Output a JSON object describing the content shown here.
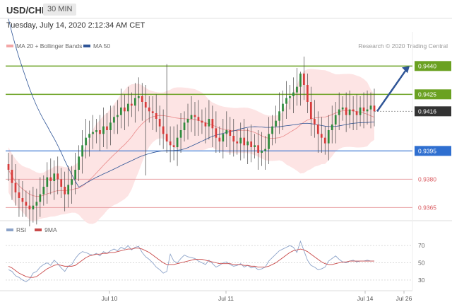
{
  "header": {
    "symbol": "USD/CHF",
    "timeframe": "30 MIN",
    "datetime": "Tuesday, July 14, 2020 2:12:34 AM CET"
  },
  "legend": {
    "ma20": "MA 20 + Bollinger Bands",
    "ma50": "MA 50",
    "copyright": "Research © 2020 Trading Central"
  },
  "rsi_legend": {
    "rsi": "RSI",
    "ma": "9MA"
  },
  "colors": {
    "band": "#fde4e4",
    "ma20": "#e57373",
    "ma50": "#2f5597",
    "resistance": "#6aa121",
    "support_blue": "#2f6fd0",
    "support_red": "#d9595f",
    "arrow": "#2f5597",
    "candle_up": "#2e8b3d",
    "candle_down": "#d63b3b",
    "rsi_line": "#8ca3c9",
    "rsi_ma": "#c94a4a"
  },
  "chart_data": {
    "type": "candlestick",
    "symbol": "USD/CHF",
    "timeframe": "30 MIN",
    "ylim": [
      0.9358,
      0.9448
    ],
    "x_ticks": [
      "Jul 10",
      "Jul 11",
      "Jul 14",
      "Jul 26"
    ],
    "levels": [
      {
        "value": 0.944,
        "label": "0.9440",
        "style": "resistance"
      },
      {
        "value": 0.9425,
        "label": "0.9425",
        "style": "resistance"
      },
      {
        "value": 0.9416,
        "label": "0.9416",
        "style": "current"
      },
      {
        "value": 0.9395,
        "label": "0.9395",
        "style": "support_blue"
      },
      {
        "value": 0.938,
        "label": "0.9380",
        "style": "support_red"
      },
      {
        "value": 0.9365,
        "label": "0.9365",
        "style": "support_red"
      }
    ],
    "projection": {
      "from": 0.9416,
      "to": 0.944,
      "direction": "up"
    },
    "close": [
      0.9385,
      0.9378,
      0.9373,
      0.937,
      0.9368,
      0.9366,
      0.9364,
      0.9366,
      0.9368,
      0.9372,
      0.9376,
      0.9381,
      0.9379,
      0.9383,
      0.938,
      0.9376,
      0.9372,
      0.9377,
      0.938,
      0.9385,
      0.9392,
      0.9398,
      0.9402,
      0.9404,
      0.9405,
      0.9406,
      0.9404,
      0.9408,
      0.9406,
      0.941,
      0.9413,
      0.9414,
      0.9418,
      0.9416,
      0.942,
      0.9419,
      0.9423,
      0.9424,
      0.9421,
      0.9418,
      0.9416,
      0.9415,
      0.9412,
      0.9408,
      0.9404,
      0.94,
      0.9398,
      0.9397,
      0.9402,
      0.9406,
      0.941,
      0.9412,
      0.9414,
      0.9413,
      0.9411,
      0.941,
      0.9408,
      0.9412,
      0.9407,
      0.9402,
      0.94,
      0.9404,
      0.9406,
      0.9403,
      0.94,
      0.9399,
      0.9402,
      0.9398,
      0.94,
      0.9397,
      0.9398,
      0.9394,
      0.9395,
      0.9396,
      0.9404,
      0.9408,
      0.9411,
      0.9416,
      0.942,
      0.9423,
      0.9424,
      0.9426,
      0.9429,
      0.9436,
      0.943,
      0.9421,
      0.9412,
      0.9409,
      0.9404,
      0.9402,
      0.9399,
      0.9406,
      0.9409,
      0.9414,
      0.9417,
      0.9418,
      0.9414,
      0.9417,
      0.9416,
      0.9414,
      0.9418,
      0.9416,
      0.9417,
      0.9419,
      0.9416
    ],
    "spikes": [
      {
        "index": 45,
        "high": 0.9441
      },
      {
        "index": 83,
        "high": 0.9437
      },
      {
        "index": 39,
        "low": 0.9382
      }
    ],
    "rsi": {
      "ticks": [
        70,
        50,
        30
      ],
      "ylim": [
        20,
        80
      ],
      "rsi_values": [
        42,
        40,
        35,
        33,
        30,
        28,
        31,
        38,
        40,
        45,
        48,
        50,
        47,
        53,
        49,
        44,
        40,
        46,
        48,
        55,
        60,
        63,
        62,
        60,
        59,
        61,
        58,
        63,
        61,
        64,
        66,
        64,
        68,
        66,
        70,
        65,
        68,
        69,
        62,
        57,
        54,
        50,
        45,
        42,
        38,
        40,
        60,
        52,
        50,
        55,
        59,
        57,
        56,
        55,
        52,
        50,
        48,
        53,
        49,
        45,
        47,
        50,
        51,
        48,
        46,
        47,
        49,
        45,
        47,
        44,
        45,
        42,
        43,
        45,
        52,
        56,
        60,
        64,
        66,
        68,
        70,
        68,
        62,
        75,
        64,
        53,
        47,
        45,
        42,
        43,
        45,
        52,
        55,
        58,
        54,
        51,
        50,
        52,
        53,
        51,
        52,
        52,
        53,
        52,
        52
      ],
      "ma_values": [
        46,
        44,
        41,
        38,
        36,
        34,
        33,
        33,
        34,
        37,
        40,
        43,
        45,
        47,
        48,
        47,
        46,
        46,
        46,
        47,
        50,
        53,
        56,
        58,
        59,
        60,
        60,
        61,
        61,
        62,
        62,
        63,
        64,
        65,
        66,
        66,
        67,
        67,
        66,
        64,
        62,
        59,
        56,
        53,
        50,
        48,
        48,
        48,
        49,
        50,
        51,
        52,
        53,
        54,
        54,
        54,
        53,
        52,
        51,
        50,
        49,
        49,
        49,
        49,
        48,
        48,
        48,
        47,
        47,
        46,
        46,
        45,
        45,
        45,
        46,
        48,
        50,
        53,
        56,
        59,
        62,
        64,
        65,
        66,
        65,
        63,
        60,
        57,
        54,
        51,
        49,
        48,
        48,
        49,
        50,
        51,
        51,
        52,
        52,
        52,
        52,
        52,
        52,
        52,
        52
      ]
    }
  }
}
